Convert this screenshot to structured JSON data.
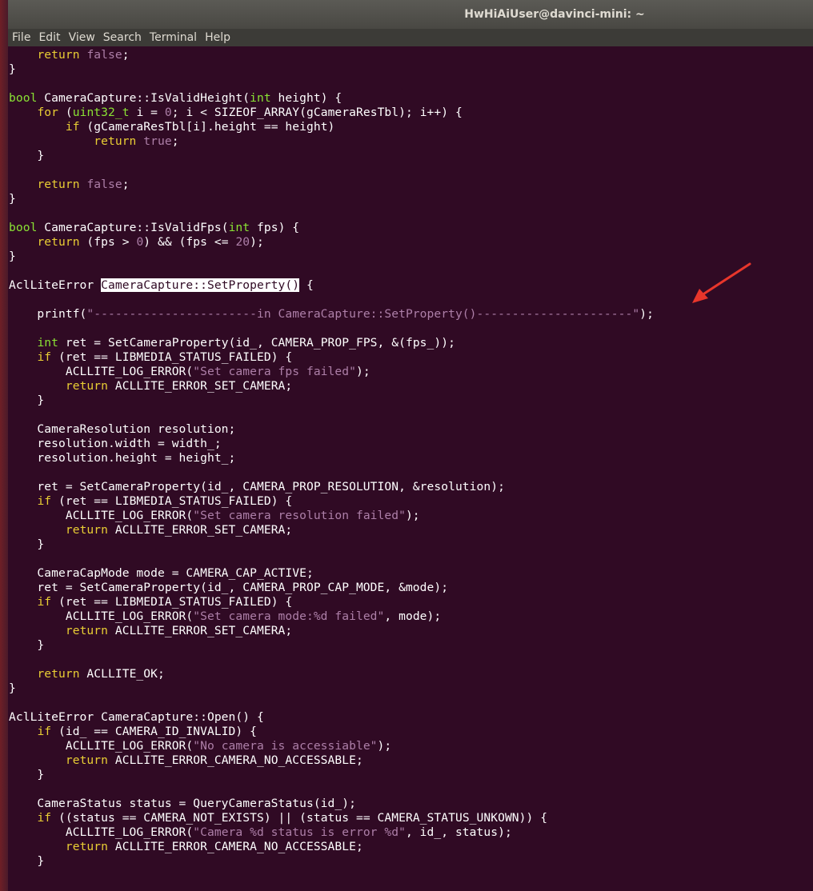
{
  "window": {
    "title": "HwHiAiUser@davinci-mini: ~"
  },
  "menu": [
    "File",
    "Edit",
    "View",
    "Search",
    "Terminal",
    "Help"
  ],
  "code": [
    {
      "segs": [
        [
          "    ",
          ""
        ],
        [
          "return",
          "kw"
        ],
        [
          " ",
          ""
        ],
        [
          "false",
          "nm"
        ],
        [
          ";",
          ""
        ]
      ]
    },
    {
      "segs": [
        [
          "}",
          ""
        ]
      ]
    },
    {
      "segs": []
    },
    {
      "segs": [
        [
          "bool",
          "ty"
        ],
        [
          " CameraCapture::IsValidHeight(",
          ""
        ],
        [
          "int",
          "ty"
        ],
        [
          " height) {",
          ""
        ]
      ]
    },
    {
      "segs": [
        [
          "    ",
          ""
        ],
        [
          "for",
          "kw"
        ],
        [
          " (",
          ""
        ],
        [
          "uint32_t",
          "ty"
        ],
        [
          " i = ",
          ""
        ],
        [
          "0",
          "nm"
        ],
        [
          "; i < SIZEOF_ARRAY(gCameraResTbl); i++) {",
          ""
        ]
      ]
    },
    {
      "segs": [
        [
          "        ",
          ""
        ],
        [
          "if",
          "kw"
        ],
        [
          " (gCameraResTbl[i].height == height)",
          ""
        ]
      ]
    },
    {
      "segs": [
        [
          "            ",
          ""
        ],
        [
          "return",
          "kw"
        ],
        [
          " ",
          ""
        ],
        [
          "true",
          "nm"
        ],
        [
          ";",
          ""
        ]
      ]
    },
    {
      "segs": [
        [
          "    }",
          ""
        ]
      ]
    },
    {
      "segs": []
    },
    {
      "segs": [
        [
          "    ",
          ""
        ],
        [
          "return",
          "kw"
        ],
        [
          " ",
          ""
        ],
        [
          "false",
          "nm"
        ],
        [
          ";",
          ""
        ]
      ]
    },
    {
      "segs": [
        [
          "}",
          ""
        ]
      ]
    },
    {
      "segs": []
    },
    {
      "segs": [
        [
          "bool",
          "ty"
        ],
        [
          " CameraCapture::IsValidFps(",
          ""
        ],
        [
          "int",
          "ty"
        ],
        [
          " fps) {",
          ""
        ]
      ]
    },
    {
      "segs": [
        [
          "    ",
          ""
        ],
        [
          "return",
          "kw"
        ],
        [
          " (fps > ",
          ""
        ],
        [
          "0",
          "nm"
        ],
        [
          ") && (fps <= ",
          ""
        ],
        [
          "20",
          "nm"
        ],
        [
          ");",
          ""
        ]
      ]
    },
    {
      "segs": [
        [
          "}",
          ""
        ]
      ]
    },
    {
      "segs": []
    },
    {
      "segs": [
        [
          "AclLiteError ",
          ""
        ],
        [
          "CameraCapture::SetProperty()",
          "sel"
        ],
        [
          " {",
          ""
        ]
      ]
    },
    {
      "segs": []
    },
    {
      "segs": [
        [
          "    printf(",
          ""
        ],
        [
          "\"-----------------------in CameraCapture::SetProperty()----------------------\"",
          "st"
        ],
        [
          ");",
          ""
        ]
      ]
    },
    {
      "segs": []
    },
    {
      "segs": [
        [
          "    ",
          ""
        ],
        [
          "int",
          "ty"
        ],
        [
          " ret = SetCameraProperty(id_, CAMERA_PROP_FPS, &(fps_));",
          ""
        ]
      ]
    },
    {
      "segs": [
        [
          "    ",
          ""
        ],
        [
          "if",
          "kw"
        ],
        [
          " (ret == LIBMEDIA_STATUS_FAILED) {",
          ""
        ]
      ]
    },
    {
      "segs": [
        [
          "        ACLLITE_LOG_ERROR(",
          ""
        ],
        [
          "\"Set camera fps failed\"",
          "st"
        ],
        [
          ");",
          ""
        ]
      ]
    },
    {
      "segs": [
        [
          "        ",
          ""
        ],
        [
          "return",
          "kw"
        ],
        [
          " ACLLITE_ERROR_SET_CAMERA;",
          ""
        ]
      ]
    },
    {
      "segs": [
        [
          "    }",
          ""
        ]
      ]
    },
    {
      "segs": []
    },
    {
      "segs": [
        [
          "    CameraResolution resolution;",
          ""
        ]
      ]
    },
    {
      "segs": [
        [
          "    resolution.width = width_;",
          ""
        ]
      ]
    },
    {
      "segs": [
        [
          "    resolution.height = height_;",
          ""
        ]
      ]
    },
    {
      "segs": []
    },
    {
      "segs": [
        [
          "    ret = SetCameraProperty(id_, CAMERA_PROP_RESOLUTION, &resolution);",
          ""
        ]
      ]
    },
    {
      "segs": [
        [
          "    ",
          ""
        ],
        [
          "if",
          "kw"
        ],
        [
          " (ret == LIBMEDIA_STATUS_FAILED) {",
          ""
        ]
      ]
    },
    {
      "segs": [
        [
          "        ACLLITE_LOG_ERROR(",
          ""
        ],
        [
          "\"Set camera resolution failed\"",
          "st"
        ],
        [
          ");",
          ""
        ]
      ]
    },
    {
      "segs": [
        [
          "        ",
          ""
        ],
        [
          "return",
          "kw"
        ],
        [
          " ACLLITE_ERROR_SET_CAMERA;",
          ""
        ]
      ]
    },
    {
      "segs": [
        [
          "    }",
          ""
        ]
      ]
    },
    {
      "segs": []
    },
    {
      "segs": [
        [
          "    CameraCapMode mode = CAMERA_CAP_ACTIVE;",
          ""
        ]
      ]
    },
    {
      "segs": [
        [
          "    ret = SetCameraProperty(id_, CAMERA_PROP_CAP_MODE, &mode);",
          ""
        ]
      ]
    },
    {
      "segs": [
        [
          "    ",
          ""
        ],
        [
          "if",
          "kw"
        ],
        [
          " (ret == LIBMEDIA_STATUS_FAILED) {",
          ""
        ]
      ]
    },
    {
      "segs": [
        [
          "        ACLLITE_LOG_ERROR(",
          ""
        ],
        [
          "\"Set camera mode:%d failed\"",
          "st"
        ],
        [
          ", mode);",
          ""
        ]
      ]
    },
    {
      "segs": [
        [
          "        ",
          ""
        ],
        [
          "return",
          "kw"
        ],
        [
          " ACLLITE_ERROR_SET_CAMERA;",
          ""
        ]
      ]
    },
    {
      "segs": [
        [
          "    }",
          ""
        ]
      ]
    },
    {
      "segs": []
    },
    {
      "segs": [
        [
          "    ",
          ""
        ],
        [
          "return",
          "kw"
        ],
        [
          " ACLLITE_OK;",
          ""
        ]
      ]
    },
    {
      "segs": [
        [
          "}",
          ""
        ]
      ]
    },
    {
      "segs": []
    },
    {
      "segs": [
        [
          "AclLiteError CameraCapture::Open() {",
          ""
        ]
      ]
    },
    {
      "segs": [
        [
          "    ",
          ""
        ],
        [
          "if",
          "kw"
        ],
        [
          " (id_ == CAMERA_ID_INVALID) {",
          ""
        ]
      ]
    },
    {
      "segs": [
        [
          "        ACLLITE_LOG_ERROR(",
          ""
        ],
        [
          "\"No camera is accessiable\"",
          "st"
        ],
        [
          ");",
          ""
        ]
      ]
    },
    {
      "segs": [
        [
          "        ",
          ""
        ],
        [
          "return",
          "kw"
        ],
        [
          " ACLLITE_ERROR_CAMERA_NO_ACCESSABLE;",
          ""
        ]
      ]
    },
    {
      "segs": [
        [
          "    }",
          ""
        ]
      ]
    },
    {
      "segs": []
    },
    {
      "segs": [
        [
          "    CameraStatus status = QueryCameraStatus(id_);",
          ""
        ]
      ]
    },
    {
      "segs": [
        [
          "    ",
          ""
        ],
        [
          "if",
          "kw"
        ],
        [
          " ((status == CAMERA_NOT_EXISTS) || (status == CAMERA_STATUS_UNKOWN)) {",
          ""
        ]
      ]
    },
    {
      "segs": [
        [
          "        ACLLITE_LOG_ERROR(",
          ""
        ],
        [
          "\"Camera %d status is error %d\"",
          "st"
        ],
        [
          ", id_, status);",
          ""
        ]
      ]
    },
    {
      "segs": [
        [
          "        ",
          ""
        ],
        [
          "return",
          "kw"
        ],
        [
          " ACLLITE_ERROR_CAMERA_NO_ACCESSABLE;",
          ""
        ]
      ]
    },
    {
      "segs": [
        [
          "    }",
          ""
        ]
      ]
    }
  ],
  "colors": {
    "background": "#300a24",
    "keyword": "#e9ce34",
    "type": "#8ae234",
    "string": "#ad7fa8",
    "arrow": "#e8362b"
  }
}
